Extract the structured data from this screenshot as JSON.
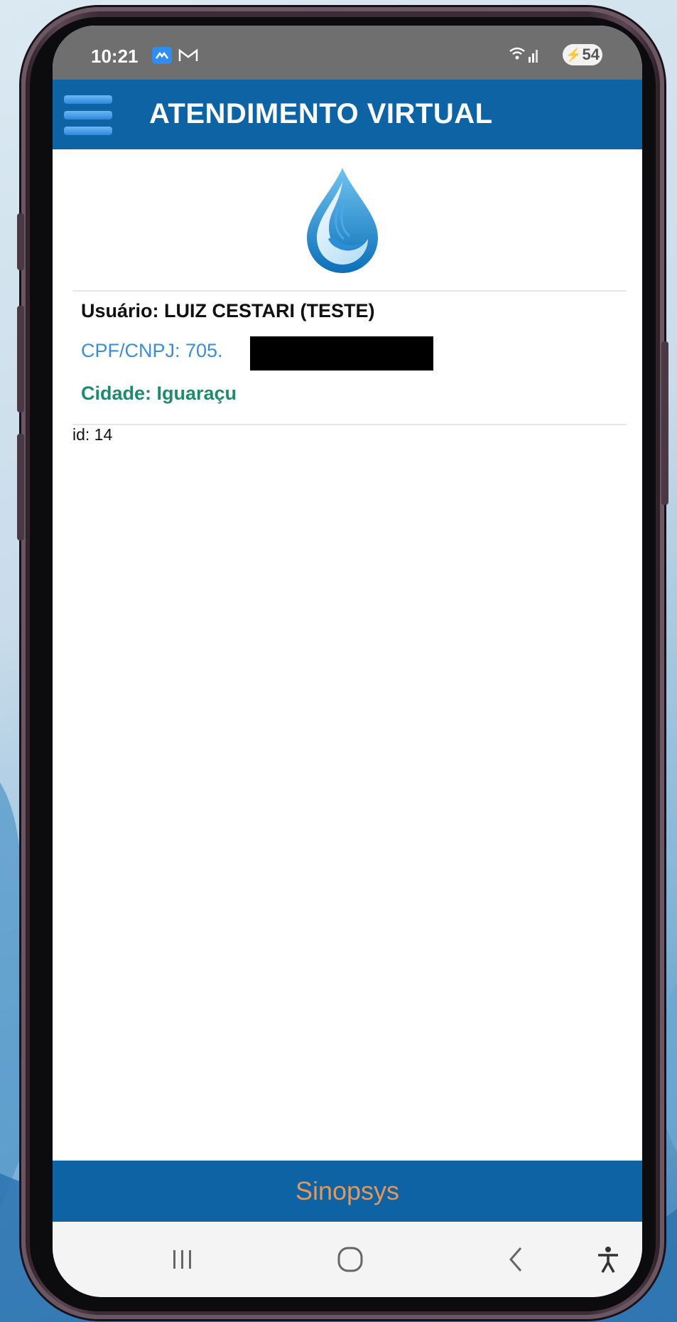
{
  "status_bar": {
    "time": "10:21",
    "battery": "54",
    "icons": [
      "app-notification-icon",
      "gmail-icon",
      "wifi-icon",
      "signal-icon",
      "battery-icon"
    ]
  },
  "header": {
    "title": "ATENDIMENTO VIRTUAL",
    "menu_icon": "hamburger-menu-icon",
    "color": "#0e63a5"
  },
  "logo": {
    "icon": "water-drop-logo-icon"
  },
  "user_info": {
    "user": "Usuário: LUIZ CESTARI (TESTE)",
    "cpf": "CPF/CNPJ: 705.",
    "city": "Cidade: Iguaraçu",
    "id": "id: 14",
    "colors": {
      "cpf": "#3b8ed4",
      "city": "#1f8a6e"
    }
  },
  "footer": {
    "text": "Sinopsys",
    "text_color": "#e2975b"
  },
  "nav": {
    "icons": [
      "recent-apps-icon",
      "home-icon",
      "back-icon",
      "accessibility-icon"
    ]
  }
}
